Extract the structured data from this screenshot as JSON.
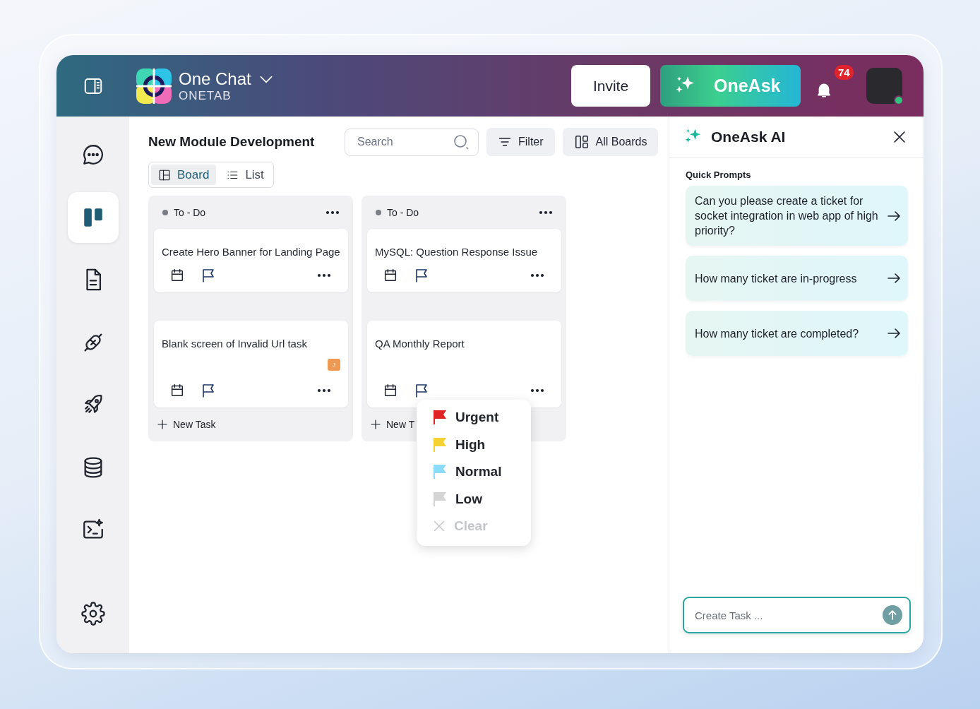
{
  "header": {
    "app_name": "One Chat",
    "workspace": "ONETAB",
    "invite_button": "Invite",
    "ask_button": "OneAsk",
    "notification_count": "74",
    "user_online": true
  },
  "sidebar": {
    "items": [
      {
        "selected": false
      },
      {
        "selected": true
      },
      {
        "selected": false
      },
      {
        "selected": false
      },
      {
        "selected": false
      },
      {
        "selected": false
      },
      {
        "selected": false
      },
      {
        "selected": false
      }
    ]
  },
  "board": {
    "title": "New Module Development",
    "search": {
      "placeholder": "Search"
    },
    "filter_button": "Filter",
    "all_boards_button": "All Boards",
    "views": [
      {
        "label": "Board",
        "selected": true
      },
      {
        "label": "List",
        "selected": false
      }
    ],
    "columns": [
      {
        "status": "To - Do",
        "new_task": "New Task",
        "cards": [
          {
            "title": "Create Hero Banner for Landing Page"
          },
          {
            "title": "Blank screen of Invalid Url task",
            "assignee": "J"
          }
        ]
      },
      {
        "status": "To - Do",
        "new_task": "New T",
        "cards": [
          {
            "title": "MySQL: Question Response Issue"
          },
          {
            "title": "QA Monthly Report",
            "priority_menu": [
              {
                "kind": "flag",
                "label": "Urgent",
                "color": "#e02424"
              },
              {
                "kind": "flag",
                "label": "High",
                "color": "#f5d131"
              },
              {
                "kind": "flag",
                "label": "Normal",
                "color": "#8adcfb"
              },
              {
                "kind": "flag",
                "label": "Low",
                "color": "#d4d4d4"
              },
              {
                "kind": "clear",
                "label": "Clear"
              }
            ]
          }
        ]
      }
    ]
  },
  "assistant": {
    "title": "OneAsk AI",
    "section_label": "Quick Prompts",
    "prompts": [
      "Can you please create a ticket for socket integration in web app of high priority?",
      "How many ticket are in-progress",
      "How many ticket are completed?"
    ],
    "input": {
      "placeholder": "Create Task ..."
    }
  }
}
